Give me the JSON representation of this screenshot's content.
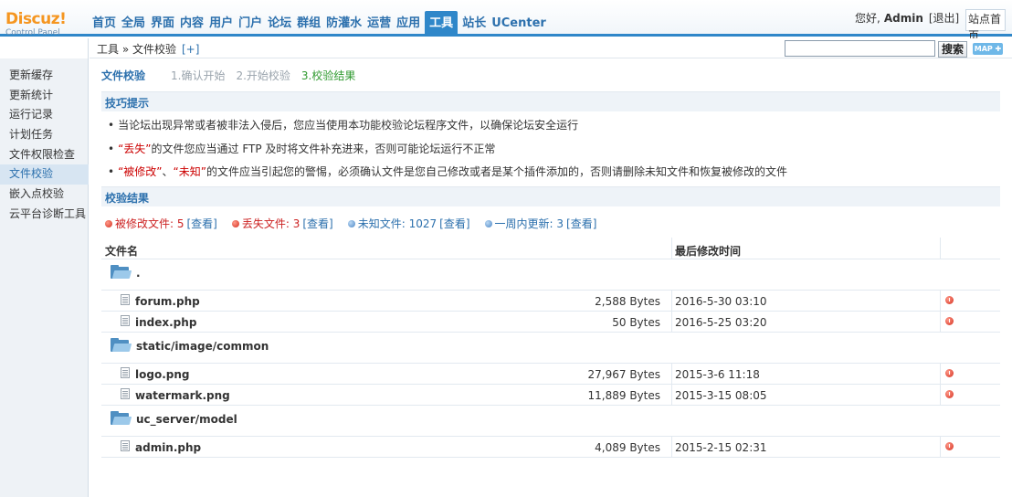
{
  "logo": {
    "main": "Discuz!",
    "sub": "Control Panel"
  },
  "topnav": [
    "首页",
    "全局",
    "界面",
    "内容",
    "用户",
    "门户",
    "论坛",
    "群组",
    "防灌水",
    "运营",
    "应用",
    "工具",
    "站长",
    "UCenter"
  ],
  "topnav_active": "工具",
  "user": {
    "greeting": "您好,",
    "name": "Admin",
    "logout": "[退出]",
    "site_home": "站点首页"
  },
  "breadcrumb": {
    "text": "工具 » 文件校验",
    "plus": "[+]"
  },
  "search": {
    "button": "搜索",
    "map": "MAP ✚"
  },
  "sidebar": [
    "更新缓存",
    "更新统计",
    "运行记录",
    "计划任务",
    "文件权限检查",
    "文件校验",
    "嵌入点校验",
    "云平台诊断工具"
  ],
  "sidebar_active": "文件校验",
  "tabs": {
    "title": "文件校验",
    "steps": [
      "1.确认开始",
      "2.开始校验",
      "3.校验结果"
    ],
    "current_step": "3.校验结果"
  },
  "tips": {
    "title": "技巧提示",
    "line1": "当论坛出现异常或者被非法入侵后，您应当使用本功能校验论坛程序文件，以确保论坛安全运行",
    "line2_red": "“丢失”",
    "line2_rest": "的文件您应当通过 FTP 及时将文件补充进来，否则可能论坛运行不正常",
    "line3_red1": "“被修改”",
    "line3_sep": "、",
    "line3_red2": "“未知”",
    "line3_rest": "的文件应当引起您的警惕，必须确认文件是您自己修改或者是某个插件添加的，否则请删除未知文件和恢复被修改的文件",
    "bullet": "•"
  },
  "results": {
    "title": "校验结果",
    "stats": [
      {
        "label": "被修改文件: 5",
        "view": "[查看]",
        "tone": "red"
      },
      {
        "label": "丢失文件: 3",
        "view": "[查看]",
        "tone": "red"
      },
      {
        "label": "未知文件: 1027",
        "view": "[查看]",
        "tone": "blue"
      },
      {
        "label": "一周内更新: 3",
        "view": "[查看]",
        "tone": "blue"
      }
    ]
  },
  "table": {
    "col_name": "文件名",
    "col_time": "最后修改时间",
    "folders": [
      {
        "name": ".",
        "files": [
          {
            "name": "forum.php",
            "size": "2,588 Bytes",
            "time": "2016-5-30 03:10"
          },
          {
            "name": "index.php",
            "size": "50 Bytes",
            "time": "2016-5-25 03:20"
          }
        ]
      },
      {
        "name": "static/image/common",
        "files": [
          {
            "name": "logo.png",
            "size": "27,967 Bytes",
            "time": "2015-3-6 11:18"
          },
          {
            "name": "watermark.png",
            "size": "11,889 Bytes",
            "time": "2015-3-15 08:05"
          }
        ]
      },
      {
        "name": "uc_server/model",
        "files": [
          {
            "name": "admin.php",
            "size": "4,089 Bytes",
            "time": "2015-2-15 02:31"
          }
        ]
      }
    ]
  }
}
